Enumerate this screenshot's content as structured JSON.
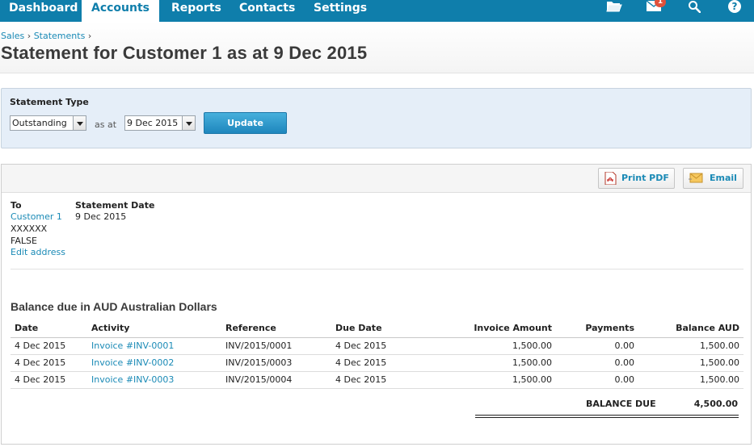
{
  "nav": {
    "tabs": [
      {
        "label": "Dashboard",
        "active": false
      },
      {
        "label": "Accounts",
        "active": true
      },
      {
        "label": "Reports",
        "active": false
      },
      {
        "label": "Contacts",
        "active": false
      },
      {
        "label": "Settings",
        "active": false
      }
    ],
    "icons": [
      "folder-icon",
      "mail-icon",
      "search-icon",
      "help-icon"
    ],
    "mail_badge": "1",
    "help_glyph": "?"
  },
  "breadcrumb": {
    "items": [
      "Sales",
      "Statements"
    ],
    "separator": "›"
  },
  "page_title": "Statement for Customer 1 as at 9 Dec 2015",
  "statement_type": {
    "label": "Statement Type",
    "type_value": "Outstanding",
    "as_at_label": "as at",
    "date_value": "9 Dec 2015",
    "update_label": "Update"
  },
  "toolbar": {
    "print_label": "Print PDF",
    "email_label": "Email"
  },
  "recipient": {
    "to_label": "To",
    "name": "Customer 1",
    "line1": "XXXXXX",
    "line2": "FALSE",
    "edit_label": "Edit address"
  },
  "statement_date": {
    "label": "Statement Date",
    "value": "9 Dec 2015"
  },
  "balance": {
    "title": "Balance due in AUD Australian Dollars",
    "columns": [
      "Date",
      "Activity",
      "Reference",
      "Due Date",
      "Invoice Amount",
      "Payments",
      "Balance AUD"
    ],
    "rows": [
      {
        "date": "4 Dec 2015",
        "activity": "Invoice #INV-0001",
        "reference": "INV/2015/0001",
        "due": "4 Dec 2015",
        "amount": "1,500.00",
        "payments": "0.00",
        "balance": "1,500.00"
      },
      {
        "date": "4 Dec 2015",
        "activity": "Invoice #INV-0002",
        "reference": "INV/2015/0003",
        "due": "4 Dec 2015",
        "amount": "1,500.00",
        "payments": "0.00",
        "balance": "1,500.00"
      },
      {
        "date": "4 Dec 2015",
        "activity": "Invoice #INV-0003",
        "reference": "INV/2015/0004",
        "due": "4 Dec 2015",
        "amount": "1,500.00",
        "payments": "0.00",
        "balance": "1,500.00"
      }
    ],
    "total_label": "BALANCE DUE",
    "total_value": "4,500.00"
  },
  "colors": {
    "nav": "#0f7eab",
    "link": "#1a8ab6",
    "panel": "#e5eef8",
    "update_button": "#2a94c8",
    "badge": "#e0513b"
  }
}
